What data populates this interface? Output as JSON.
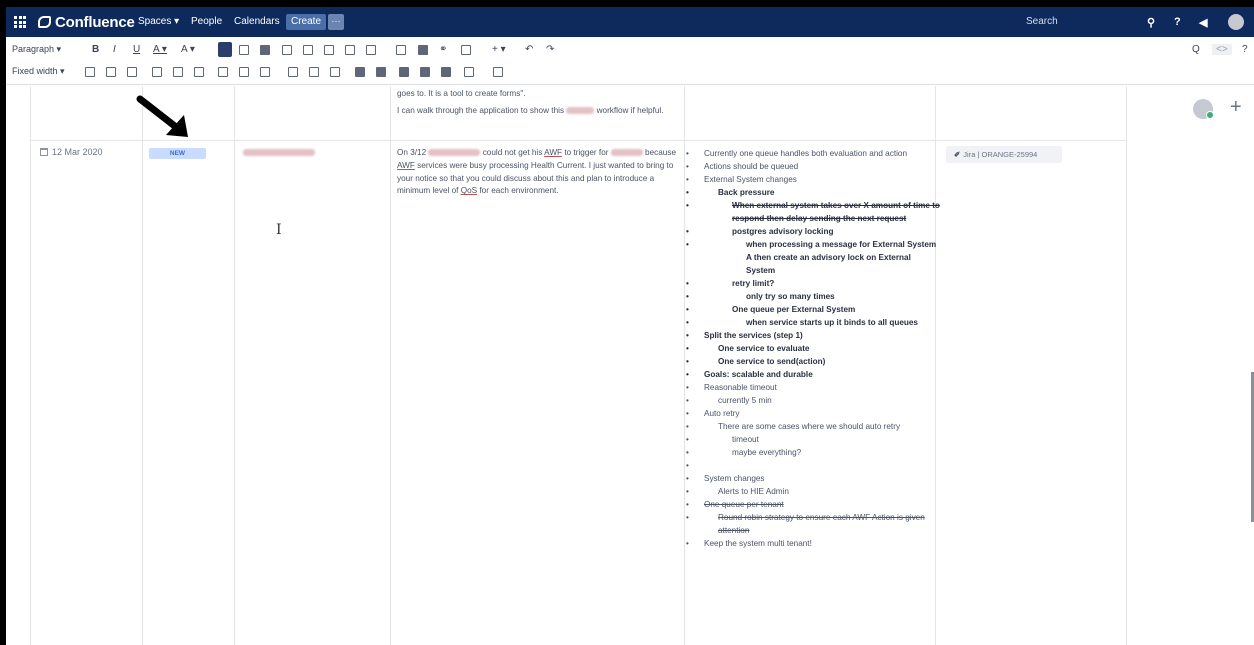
{
  "topnav": {
    "brand": "Confluence",
    "links": [
      "Spaces ▾",
      "People",
      "Calendars"
    ],
    "create": "Create",
    "more": "···",
    "search_placeholder": "Search"
  },
  "toolbar": {
    "paragraph": "Paragraph ▾",
    "bold": "B",
    "italic": "I",
    "underline": "U",
    "text_color": "A ▾",
    "more_format": "A ▾",
    "undo": "↶",
    "redo": "↷",
    "find": "Q",
    "source": "<>",
    "help": "?",
    "width": "Fixed width ▾",
    "insert_more": "+ ▾"
  },
  "row_prev": {
    "text1": "goes to.  It is a tool to create forms\".",
    "text2a": "I can walk through the application to show this",
    "text2b": "workflow if helpful."
  },
  "row": {
    "date": "12 Mar 2020",
    "status": "NEW",
    "desc_1": "On 3/12",
    "desc_2": "could not get his",
    "desc_awf": "AWF",
    "desc_3": "to trigger for",
    "desc_4": "because",
    "desc_5": "services were busy processing Health Current. I just wanted to bring to your notice so that you could discuss about this and plan to introduce a minimum level of",
    "desc_qos": "QoS",
    "desc_6": "for each environment.",
    "jira_icon": "✐",
    "jira": "Jira | ORANGE-25994"
  },
  "notes": [
    {
      "level": 1,
      "text": "Currently one queue handles both evaluation and action",
      "bold": false,
      "strike": false
    },
    {
      "level": 1,
      "text": "Actions should be queued",
      "bold": false,
      "strike": false
    },
    {
      "level": 1,
      "text": "External System changes",
      "bold": false,
      "strike": false
    },
    {
      "level": 2,
      "text": "Back pressure",
      "bold": true,
      "strike": false
    },
    {
      "level": 3,
      "text": "When external system takes over X amount of time to respond then delay sending the next request",
      "bold": true,
      "strike": true
    },
    {
      "level": 3,
      "text": "postgres advisory locking",
      "bold": true,
      "strike": false
    },
    {
      "level": 4,
      "text": "when processing a message for External System A then create an advisory lock on External System",
      "bold": true,
      "strike": false
    },
    {
      "level": 3,
      "text": "retry limit?",
      "bold": true,
      "strike": false
    },
    {
      "level": 4,
      "text": "only try so many times",
      "bold": true,
      "strike": false
    },
    {
      "level": 3,
      "text": "One queue per External System",
      "bold": true,
      "strike": false
    },
    {
      "level": 4,
      "text": "when service starts up it binds to all queues",
      "bold": true,
      "strike": false
    },
    {
      "level": 1,
      "text": "Split the services (step 1)",
      "bold": true,
      "strike": false
    },
    {
      "level": 2,
      "text": "One service to evaluate",
      "bold": true,
      "strike": false
    },
    {
      "level": 2,
      "text": "One service to send(action)",
      "bold": true,
      "strike": false
    },
    {
      "level": 1,
      "text": "Goals: scalable and durable",
      "bold": true,
      "strike": false
    },
    {
      "level": 1,
      "text": "Reasonable timeout",
      "bold": false,
      "strike": false
    },
    {
      "level": 2,
      "text": "currently 5 min",
      "bold": false,
      "strike": false
    },
    {
      "level": 1,
      "text": "Auto retry",
      "bold": false,
      "strike": false
    },
    {
      "level": 2,
      "text": "There are some cases where we should auto retry",
      "bold": false,
      "strike": false
    },
    {
      "level": 3,
      "text": "timeout",
      "bold": false,
      "strike": false
    },
    {
      "level": 3,
      "text": "maybe everything?",
      "bold": false,
      "strike": false
    },
    {
      "level": 3,
      "text": "",
      "bold": false,
      "strike": false
    },
    {
      "level": 1,
      "text": "System changes",
      "bold": false,
      "strike": false
    },
    {
      "level": 2,
      "text": "Alerts to HIE Admin",
      "bold": false,
      "strike": false
    },
    {
      "level": 1,
      "text": "One queue per tenant",
      "bold": false,
      "strike": true
    },
    {
      "level": 2,
      "text": "Round robin strategy to ensure each AWF Action is given attention",
      "bold": false,
      "strike": true
    },
    {
      "level": 1,
      "text": "Keep the system multi tenant!",
      "bold": false,
      "strike": false
    }
  ],
  "right_pane": {
    "add": "+"
  },
  "colors": {
    "nav_bg": "#0e2a5c",
    "lozenge_bg": "#c8dcff",
    "lozenge_text": "#3e6ad6"
  }
}
